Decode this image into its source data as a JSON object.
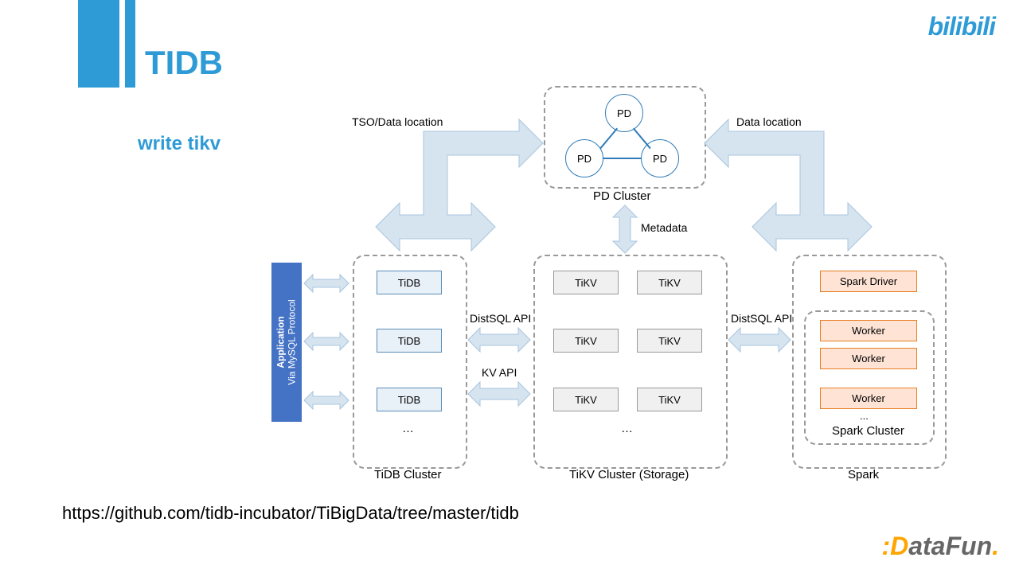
{
  "title": "TIDB",
  "subtitle": "write tikv",
  "url": "https://github.com/tidb-incubator/TiBigData/tree/master/tidb",
  "logo_bilibili": "bilibili",
  "logo_datafun_d": "D",
  "logo_datafun_rest": "ataFun",
  "labels": {
    "tso": "TSO/Data location",
    "dataloc": "Data location",
    "metadata": "Metadata",
    "distsql1": "DistSQL API",
    "distsql2": "DistSQL API",
    "kvapi": "KV API",
    "app_line1": "Application",
    "app_line2": "Via MySQL Protocol"
  },
  "clusters": {
    "pd": "PD Cluster",
    "tidb": "TiDB Cluster",
    "tikv": "TiKV Cluster (Storage)",
    "spark_inner": "Spark Cluster",
    "spark_outer": "Spark"
  },
  "nodes": {
    "pd": "PD",
    "tidb": "TiDB",
    "tikv": "TiKV",
    "spark_driver": "Spark Driver",
    "worker": "Worker",
    "ellipsis": "…",
    "ellipsis3": "..."
  }
}
